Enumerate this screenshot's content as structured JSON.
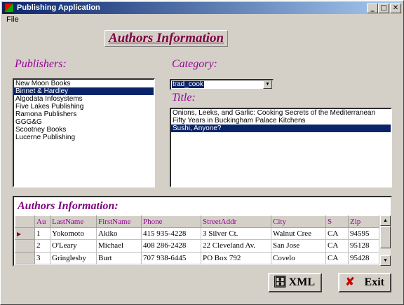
{
  "window": {
    "title": "Publishing Application",
    "minimize": "_",
    "maximize": "□",
    "close": "✕"
  },
  "menu": {
    "file_label": "File"
  },
  "header": {
    "title": "Authors Information"
  },
  "publishers": {
    "label": "Publishers:",
    "items": [
      "New Moon Books",
      "Binnet & Hardley",
      "Algodata Infosystems",
      "Five Lakes Publishing",
      "Ramona Publishers",
      "GGG&G",
      "Scootney Books",
      "Lucerne Publishing"
    ],
    "selected_index": 1
  },
  "category": {
    "label": "Category:",
    "value": "trad_cook"
  },
  "titles": {
    "label": "Title:",
    "items": [
      "Onions, Leeks, and Garlic: Cooking Secrets of the Mediterranean",
      "Fifty Years in Buckingham Palace Kitchens",
      "Sushi, Anyone?"
    ],
    "selected_index": 2
  },
  "authors": {
    "caption": "Authors Information:",
    "columns": [
      "Au",
      "LastName",
      "FirstName",
      "Phone",
      "StreetAddr",
      "City",
      "S",
      "Zip"
    ],
    "rows": [
      [
        "1",
        "Yokomoto",
        "Akiko",
        "415 935-4228",
        "3 Silver Ct.",
        "Walnut Cree",
        "CA",
        "94595"
      ],
      [
        "2",
        "O'Leary",
        "Michael",
        "408 286-2428",
        "22 Cleveland Av.",
        "San Jose",
        "CA",
        "95128"
      ],
      [
        "3",
        "Gringlesby",
        "Burt",
        "707 938-6445",
        "PO Box 792",
        "Covelo",
        "CA",
        "95428"
      ]
    ]
  },
  "buttons": {
    "xml_label": "XML",
    "exit_label": "Exit"
  },
  "icons": {
    "app": "app-icon",
    "xml": "database-icon",
    "exit": "red-x-icon"
  }
}
